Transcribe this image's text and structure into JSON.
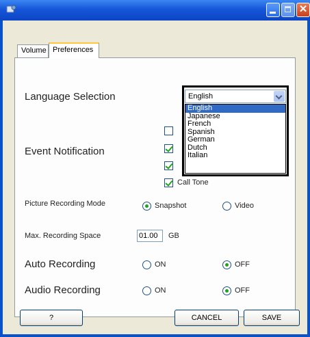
{
  "tabs": [
    {
      "label": "Volume"
    },
    {
      "label": "Preferences"
    }
  ],
  "language": {
    "label": "Language Selection",
    "selected": "English",
    "options": [
      "English",
      "Japanese",
      "French",
      "Spanish",
      "German",
      "Dutch",
      "Italian"
    ]
  },
  "event_notification": {
    "label": "Event Notification",
    "items": [
      {
        "label": "",
        "checked": false
      },
      {
        "label": "",
        "checked": true
      },
      {
        "label": "",
        "checked": true
      },
      {
        "label": "Call Tone",
        "checked": true
      }
    ]
  },
  "picture_mode": {
    "label": "Picture Recording Mode",
    "option_a": "Snapshot",
    "option_b": "Video",
    "selected": "Snapshot"
  },
  "max_space": {
    "label": "Max. Recording Space",
    "value": "01.00",
    "unit": "GB"
  },
  "auto_recording": {
    "label": "Auto Recording",
    "on": "ON",
    "off": "OFF",
    "selected": "OFF"
  },
  "audio_recording": {
    "label": "Audio Recording",
    "on": "ON",
    "off": "OFF",
    "selected": "OFF"
  },
  "buttons": {
    "help": "?",
    "cancel": "CANCEL",
    "save": "SAVE"
  },
  "colors": {
    "titlebar": "#1656d8",
    "window_bg": "#ece9d8",
    "tab_accent": "#ffc83c",
    "selection": "#316ac5",
    "check": "#21a121"
  }
}
